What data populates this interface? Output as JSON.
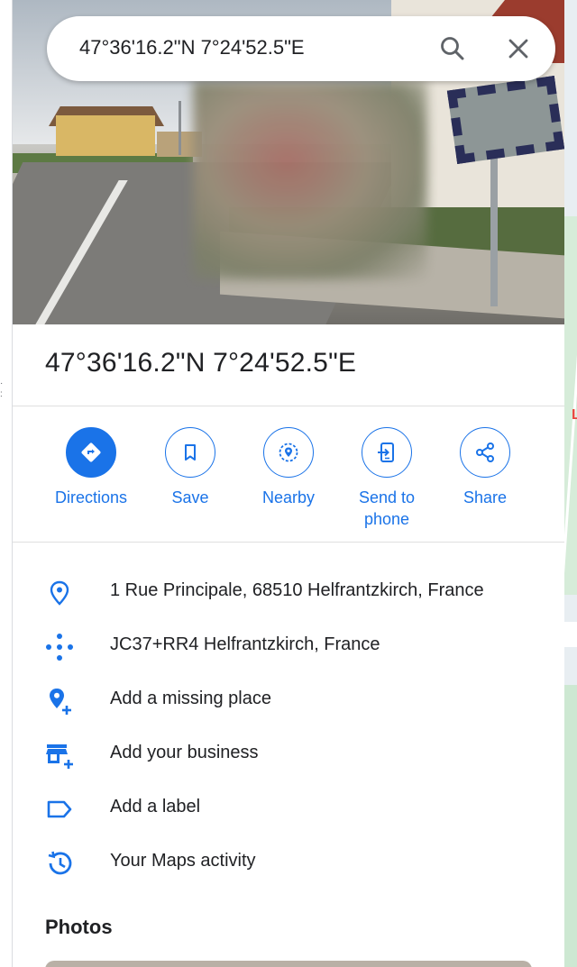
{
  "search": {
    "value": "47°36'16.2\"N 7°24'52.5\"E"
  },
  "place": {
    "title": "47°36'16.2\"N 7°24'52.5\"E"
  },
  "actions": [
    {
      "label": "Directions",
      "icon": "directions-icon"
    },
    {
      "label": "Save",
      "icon": "bookmark-icon"
    },
    {
      "label": "Nearby",
      "icon": "nearby-icon"
    },
    {
      "label": "Send to\nphone",
      "icon": "send-to-phone-icon"
    },
    {
      "label": "Share",
      "icon": "share-icon"
    }
  ],
  "info": {
    "address": "1 Rue Principale, 68510 Helfrantzkirch, France",
    "plus_code": "JC37+RR4 Helfrantzkirch, France",
    "add_missing_place": "Add a missing place",
    "add_business": "Add your business",
    "add_label": "Add a label",
    "maps_activity": "Your Maps activity"
  },
  "photos": {
    "heading": "Photos"
  },
  "colors": {
    "accent": "#1a73e8",
    "text": "#202124"
  }
}
